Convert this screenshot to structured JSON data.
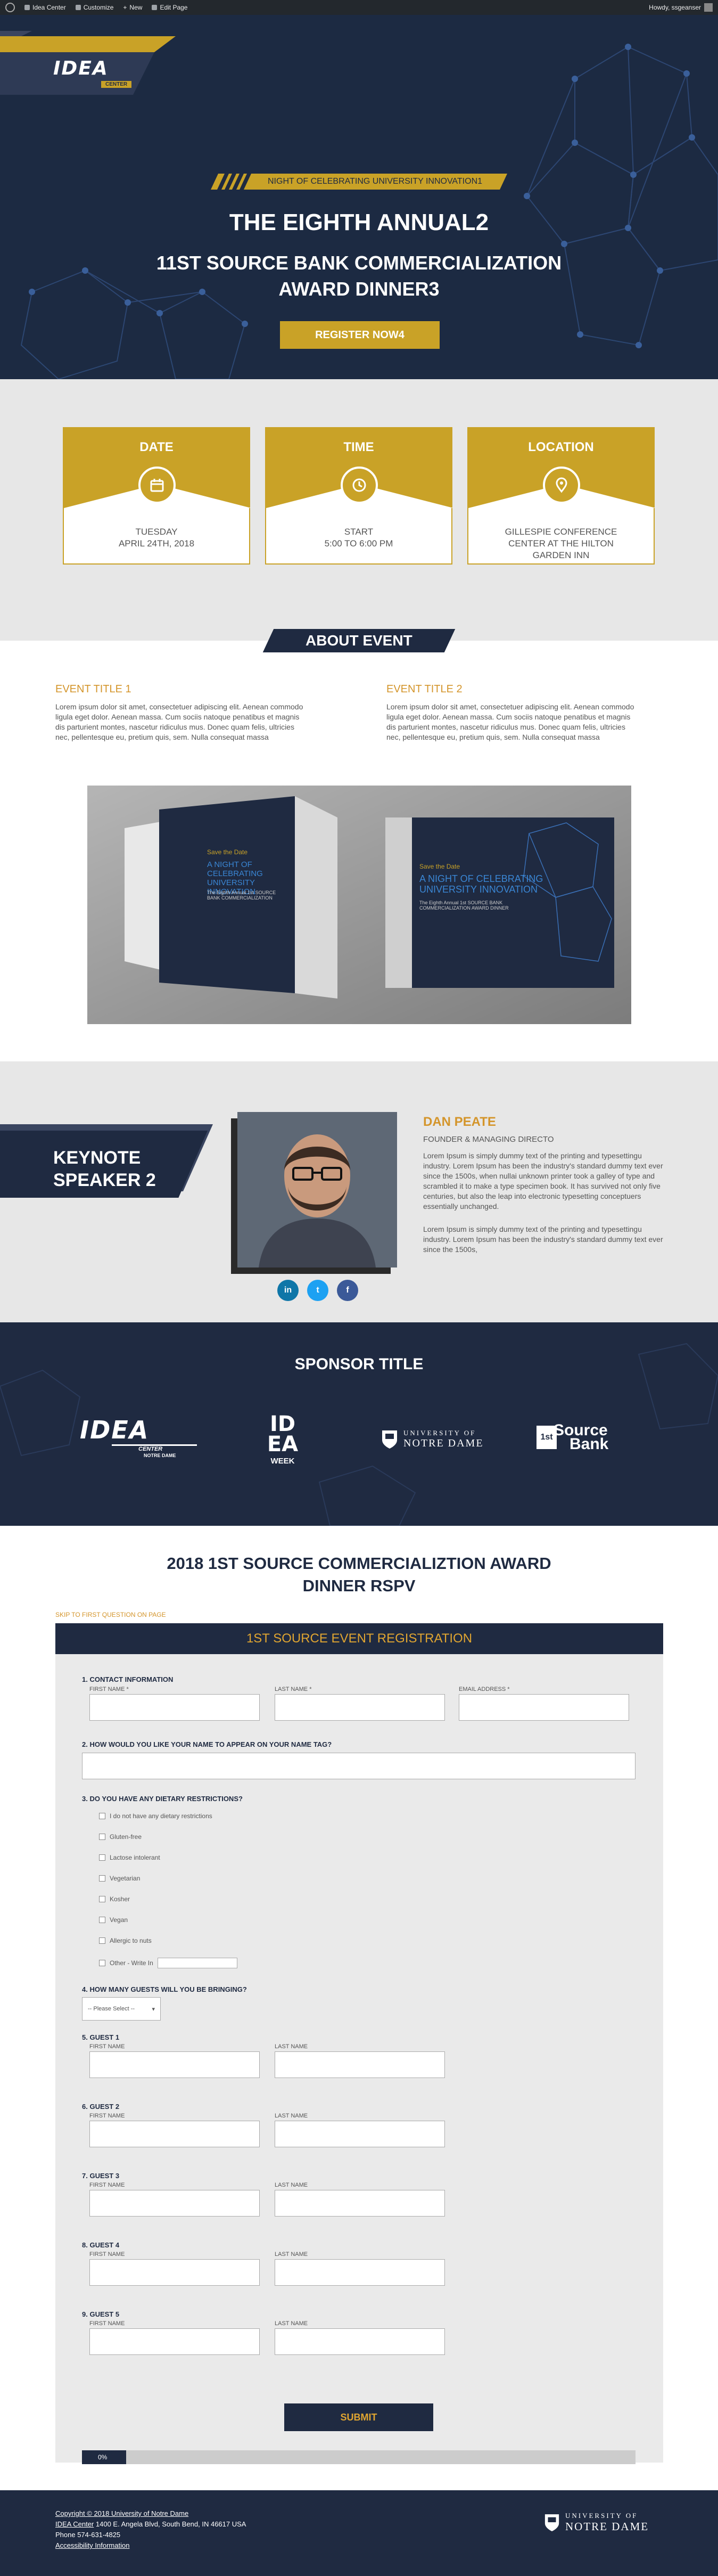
{
  "adminbar": {
    "site": "Idea Center",
    "customize": "Customize",
    "new": "New",
    "edit": "Edit Page",
    "howdy": "Howdy, ssgeanser"
  },
  "hero": {
    "logo": "IDEA",
    "logo_sub": "CENTER",
    "tagline": "NIGHT OF CELEBRATING UNIVERSITY INNOVATION1",
    "title1": "THE EIGHTH ANNUAL2",
    "title2": "11ST SOURCE BANK COMMERCIALIZATION",
    "title3": "AWARD DINNER3",
    "register": "REGISTER NOW4"
  },
  "info": {
    "cards": [
      {
        "title": "DATE",
        "icon": "calendar-icon",
        "line1": "TUESDAY",
        "line2": "APRIL 24TH, 2018",
        "line3": ""
      },
      {
        "title": "TIME",
        "icon": "clock-icon",
        "line1": "START",
        "line2": "5:00 TO 6:00 PM",
        "line3": ""
      },
      {
        "title": "LOCATION",
        "icon": "map-pin-icon",
        "line1": "GILLESPIE CONFERENCE",
        "line2": "CENTER AT THE HILTON",
        "line3": "GARDEN INN"
      }
    ]
  },
  "about": {
    "banner": "ABOUT EVENT",
    "event1_title": "EVENT TITLE 1",
    "event1_text": "Lorem ipsum dolor sit amet, consectetuer adipiscing elit. Aenean commodo ligula eget dolor. Aenean massa. Cum sociis natoque penatibus et magnis dis parturient montes, nascetur ridiculus mus. Donec quam felis, ultricies nec, pellentesque eu, pretium quis, sem. Nulla consequat massa",
    "event2_title": "EVENT TITLE 2",
    "event2_text": "Lorem ipsum dolor sit amet, consectetuer adipiscing elit. Aenean commodo ligula eget dolor. Aenean massa. Cum sociis natoque penatibus et magnis dis parturient montes, nascetur ridiculus mus. Donec quam felis, ultricies nec, pellentesque eu, pretium quis, sem. Nulla consequat massa",
    "card1_heading": "Save the Date",
    "card1_title": "A NIGHT OF CELEBRATING UNIVERSITY INNOVATION",
    "card1_sub": "The Eighth Annual 1st SOURCE BANK COMMERCIALIZATION",
    "card2_heading": "Save the Date",
    "card2_title": "A NIGHT OF CELEBRATING UNIVERSITY INNOVATION",
    "card2_sub": "The Eighth Annual 1st SOURCE BANK COMMERCIALIZATION AWARD DINNER"
  },
  "keynote": {
    "banner_line1": "KEYNOTE",
    "banner_line2": "SPEAKER 2",
    "name": "DAN PEATE",
    "role": "FOUNDER & MANAGING DIRECTO",
    "p1": "Lorem Ipsum is simply dummy text of the printing and typesettingu industry. Lorem Ipsum has been the industry's standard dummy text ever since the 1500s, when nullai unknown printer took a galley of type and scrambled it to make a type specimen book. It has survived not only five centuries, but also the leap into electronic typesetting conceptuers essentially unchanged.",
    "p2": "Lorem Ipsum is simply dummy text of the printing and typesettingu industry. Lorem Ipsum has been the industry's standard dummy text ever since the 1500s,",
    "social": [
      "in",
      "t",
      "f"
    ]
  },
  "sponsor": {
    "title": "SPONSOR TITLE",
    "idea": "IDEA",
    "idea_sub": "CENTER",
    "idea_tiny": "NOTRE DAME",
    "week_top": "IDEA",
    "week": "WEEK",
    "nd_line1": "UNIVERSITY OF",
    "nd_line2": "NOTRE DAME",
    "source1": "Source",
    "source2": "Bank",
    "source_prefix": "1st"
  },
  "rsvp": {
    "title_line1": "2018 1ST SOURCE COMMERCIALIZTION AWARD",
    "title_line2": "DINNER RSPV",
    "skip": "SKIP TO FIRST QUESTION ON PAGE",
    "form_title": "1ST SOURCE EVENT REGISTRATION",
    "q1": "1. CONTACT INFORMATION",
    "first_name": "FIRST NAME *",
    "last_name": "LAST NAME *",
    "email": "EMAIL ADDRESS *",
    "q2": "2. HOW WOULD YOU LIKE YOUR NAME TO APPEAR ON YOUR NAME TAG?",
    "q3": "3. DO YOU HAVE ANY DIETARY RESTRICTIONS?",
    "dietary": [
      "I do not have any dietary restrictions",
      "Gluten-free",
      "Lactose intolerant",
      "Vegetarian",
      "Kosher",
      "Vegan",
      "Allergic to nuts",
      "Other - Write In"
    ],
    "q4": "4. HOW MANY GUESTS WILL YOU BE BRINGING?",
    "select": "-- Please Select --",
    "guests": [
      "5. GUEST 1",
      "6. GUEST 2",
      "7. GUEST 3",
      "8. GUEST 4",
      "9. GUEST 5"
    ],
    "g_first": "FIRST NAME",
    "g_last": "LAST NAME",
    "submit": "SUBMIT",
    "progress": "0%",
    "progress_value": 0
  },
  "footer": {
    "copyright": "Copyright © 2018 University of Notre Dame",
    "address_link": "IDEA Center",
    "address": " 1400 E. Angela Blvd, South Bend, IN 46617 USA",
    "phone": "Phone 574-631-4825",
    "accessibility": "Accessibility Information",
    "nd_line1": "UNIVERSITY OF",
    "nd_line2": "NOTRE DAME"
  },
  "colors": {
    "navy": "#1f2a41",
    "gold": "#c9a227",
    "orange": "#d4952b",
    "linkedin": "#0e76a8",
    "twitter": "#1da1f2",
    "facebook": "#3b5998"
  }
}
